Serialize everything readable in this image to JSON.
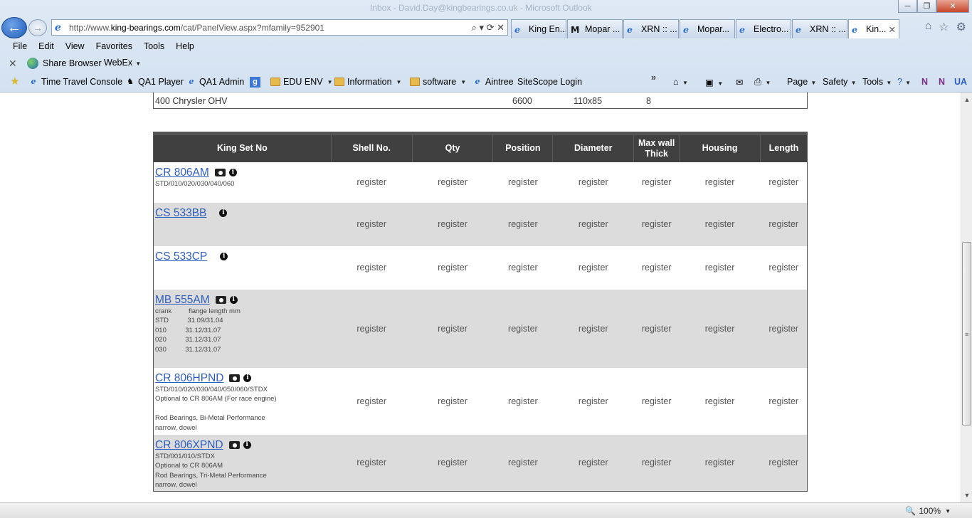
{
  "window": {
    "title_faint": "Inbox - David.Day@kingbearings.co.uk - Microsoft Outlook",
    "minimize_label": "─",
    "maximize_label": "❐",
    "close_label": "✕"
  },
  "nav": {
    "back_label": "←",
    "forward_label": "→",
    "url_prefix": "http://www.",
    "url_host": "king-bearings.com",
    "url_path": "/cat/PanelView.aspx?mfamily=952901",
    "addr_tools": "⌕ ▾ ⟳ ✕"
  },
  "tabs": [
    {
      "label": "King En...",
      "icon": "ie-icon"
    },
    {
      "label": "Mopar ...",
      "icon": "mopar-icon"
    },
    {
      "label": "XRN :: ...",
      "icon": "ie-icon"
    },
    {
      "label": "Mopar...",
      "icon": "ie-icon"
    },
    {
      "label": "Electro...",
      "icon": "ie-icon"
    },
    {
      "label": "XRN :: ...",
      "icon": "ie-icon"
    },
    {
      "label": "Kin...",
      "icon": "ie-icon",
      "active": true
    }
  ],
  "tab_close": "✕",
  "menu": [
    "File",
    "Edit",
    "View",
    "Favorites",
    "Tools",
    "Help"
  ],
  "commandbar": {
    "close": "✕",
    "share_browser": "Share Browser",
    "webex": "WebEx"
  },
  "favorites": {
    "time_travel": "Time Travel Console",
    "qa1_player": "QA1 Player",
    "qa1_admin": "QA1 Admin",
    "edu_env": "EDU ENV",
    "information": "Information",
    "software": "software",
    "aintree": "Aintree",
    "sitescope": "SiteScope Login",
    "more": "»"
  },
  "ie_commands": {
    "page": "Page",
    "safety": "Safety",
    "tools": "Tools",
    "ua": "UA"
  },
  "previous_row": {
    "engine": "400 Chrysler OHV",
    "value1": "6600",
    "value2": "110x85",
    "value3": "8"
  },
  "table": {
    "headers": [
      "King Set No",
      "Shell No.",
      "Qty",
      "Position",
      "Diameter",
      "Max wall Thick",
      "Housing",
      "Length"
    ],
    "rows": [
      {
        "set": "CR 806AM",
        "camera": true,
        "info": true,
        "details": "STD/010/020/030/040/060",
        "cells": [
          "register",
          "register",
          "register",
          "register",
          "register",
          "register",
          "register"
        ]
      },
      {
        "set": "CS 533BB",
        "camera": false,
        "info": true,
        "details": "",
        "cells": [
          "register",
          "register",
          "register",
          "register",
          "register",
          "register",
          "register"
        ]
      },
      {
        "set": "CS 533CP",
        "camera": false,
        "info": true,
        "details": "",
        "cells": [
          "register",
          "register",
          "register",
          "register",
          "register",
          "register",
          "register"
        ]
      },
      {
        "set": "MB 555AM",
        "camera": true,
        "info": true,
        "details": "crank         flange length mm\nSTD          31.09/31.04\n010          31.12/31.07\n020          31.12/31.07\n030          31.12/31.07",
        "cells": [
          "register",
          "register",
          "register",
          "register",
          "register",
          "register",
          "register"
        ]
      },
      {
        "set": "CR 806HPND",
        "camera": true,
        "info": true,
        "details": "STD/010/020/030/040/050/060/STDX\nOptional to CR 806AM (For race engine)\n\nRod Bearings, Bi-Metal Performance\nnarrow, dowel",
        "cells": [
          "register",
          "register",
          "register",
          "register",
          "register",
          "register",
          "register"
        ]
      },
      {
        "set": "CR 806XPND",
        "camera": true,
        "info": true,
        "details": "STD/001/010/STDX\nOptional to CR 806AM\nRod Bearings, Tri-Metal Performance\nnarrow, dowel",
        "cells": [
          "register",
          "register",
          "register",
          "register",
          "register",
          "register",
          "register"
        ]
      }
    ]
  },
  "status": {
    "zoom": "100%"
  }
}
